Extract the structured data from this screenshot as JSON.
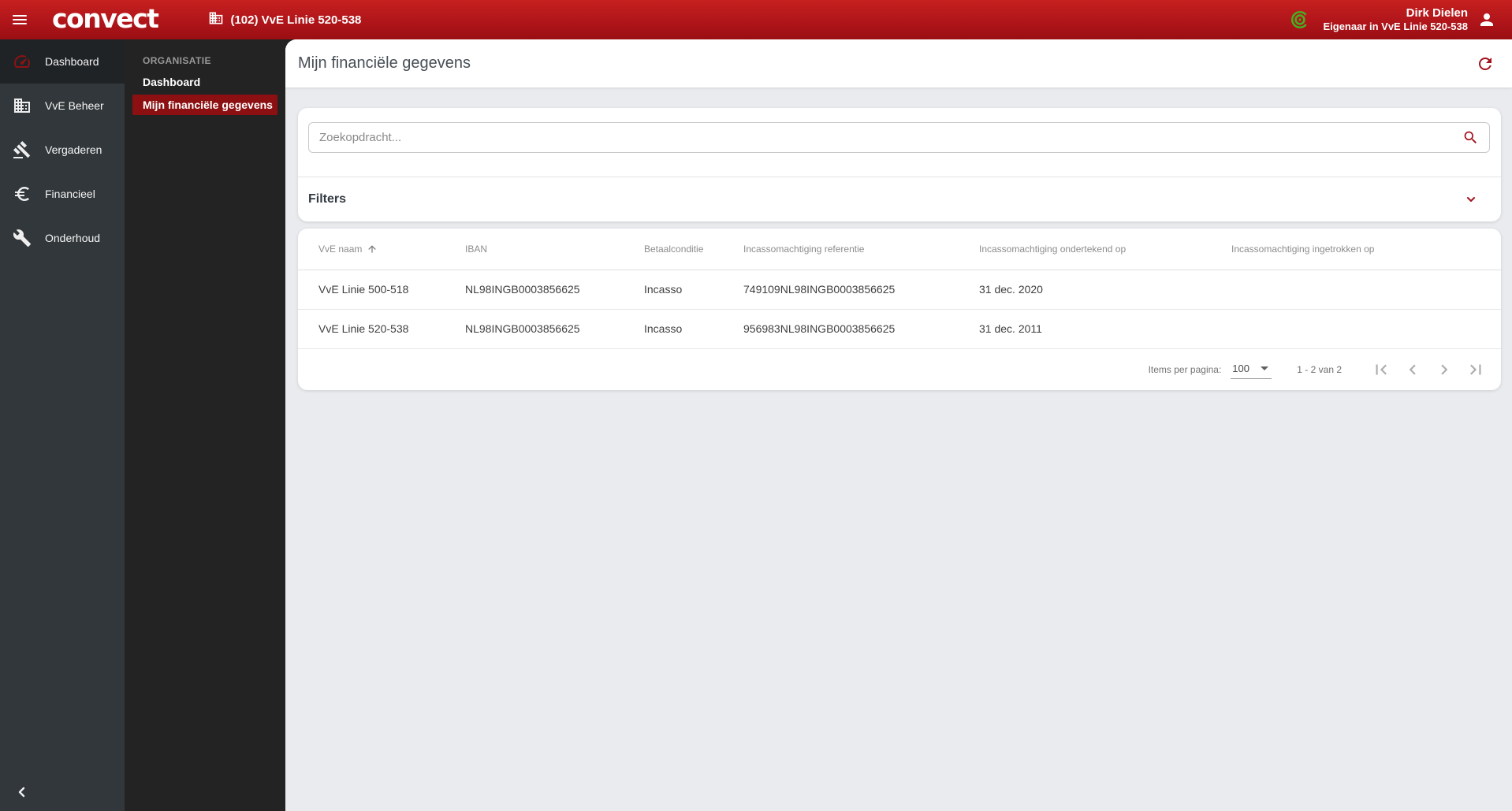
{
  "topbar": {
    "logo_text": "convect",
    "building_chip": "(102) VvE Linie 520-538",
    "user": {
      "name": "Dirk Dielen",
      "role": "Eigenaar in VvE Linie 520-538"
    }
  },
  "sidebar": {
    "items": [
      {
        "label": "Dashboard",
        "icon": "gauge-icon",
        "active": true
      },
      {
        "label": "VvE Beheer",
        "icon": "building-icon",
        "active": false
      },
      {
        "label": "Vergaderen",
        "icon": "gavel-icon",
        "active": false
      },
      {
        "label": "Financieel",
        "icon": "euro-icon",
        "active": false
      },
      {
        "label": "Onderhoud",
        "icon": "wrench-icon",
        "active": false
      }
    ]
  },
  "subnav": {
    "section_label": "ORGANISATIE",
    "items": [
      {
        "label": "Dashboard",
        "active": false
      },
      {
        "label": "Mijn financiële gegevens",
        "active": true
      }
    ]
  },
  "page": {
    "title": "Mijn financiële gegevens",
    "search_placeholder": "Zoekopdracht...",
    "filters_label": "Filters"
  },
  "table": {
    "columns": [
      "VvE naam",
      "IBAN",
      "Betaalconditie",
      "Incassomachtiging referentie",
      "Incassomachtiging ondertekend op",
      "Incassomachtiging ingetrokken op"
    ],
    "sort": {
      "column": "VvE naam",
      "direction": "asc"
    },
    "rows": [
      [
        "VvE Linie 500-518",
        "NL98INGB0003856625",
        "Incasso",
        "749109NL98INGB0003856625",
        "31 dec. 2020",
        ""
      ],
      [
        "VvE Linie 520-538",
        "NL98INGB0003856625",
        "Incasso",
        "956983NL98INGB0003856625",
        "31 dec. 2011",
        ""
      ]
    ]
  },
  "pagination": {
    "items_per_page_label": "Items per pagina:",
    "items_per_page_value": "100",
    "range_label": "1 - 2 van 2"
  },
  "colors": {
    "brand_red_top": "#c6201f",
    "brand_red_bottom": "#9a0e13",
    "accent_red": "#a3121c",
    "active_nav_red": "#8c1012",
    "rail_bg": "#32373b",
    "subnav_bg": "#232323",
    "content_bg": "#e9ebee",
    "online_green": "#47ad21"
  }
}
